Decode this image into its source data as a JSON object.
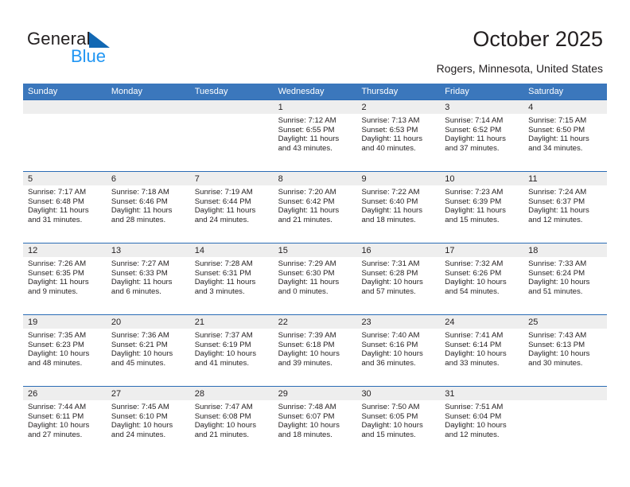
{
  "brand": {
    "name_part1": "General",
    "name_part2": "Blue",
    "accent_color": "#1268b3",
    "secondary_color": "#2196f3"
  },
  "header": {
    "title": "October 2025",
    "subtitle": "Rogers, Minnesota, United States"
  },
  "theme": {
    "header_band_color": "#3b77bc",
    "row_divider_color": "#2b6cb5",
    "daynum_strip_color": "#eeeeee",
    "text_color": "#231f20"
  },
  "weekdays": [
    "Sunday",
    "Monday",
    "Tuesday",
    "Wednesday",
    "Thursday",
    "Friday",
    "Saturday"
  ],
  "weeks": [
    [
      {
        "day": "",
        "sunrise": "",
        "sunset": "",
        "daylight": "",
        "empty": true
      },
      {
        "day": "",
        "sunrise": "",
        "sunset": "",
        "daylight": "",
        "empty": true
      },
      {
        "day": "",
        "sunrise": "",
        "sunset": "",
        "daylight": "",
        "empty": true
      },
      {
        "day": "1",
        "sunrise": "Sunrise: 7:12 AM",
        "sunset": "Sunset: 6:55 PM",
        "daylight": "Daylight: 11 hours and 43 minutes."
      },
      {
        "day": "2",
        "sunrise": "Sunrise: 7:13 AM",
        "sunset": "Sunset: 6:53 PM",
        "daylight": "Daylight: 11 hours and 40 minutes."
      },
      {
        "day": "3",
        "sunrise": "Sunrise: 7:14 AM",
        "sunset": "Sunset: 6:52 PM",
        "daylight": "Daylight: 11 hours and 37 minutes."
      },
      {
        "day": "4",
        "sunrise": "Sunrise: 7:15 AM",
        "sunset": "Sunset: 6:50 PM",
        "daylight": "Daylight: 11 hours and 34 minutes."
      }
    ],
    [
      {
        "day": "5",
        "sunrise": "Sunrise: 7:17 AM",
        "sunset": "Sunset: 6:48 PM",
        "daylight": "Daylight: 11 hours and 31 minutes."
      },
      {
        "day": "6",
        "sunrise": "Sunrise: 7:18 AM",
        "sunset": "Sunset: 6:46 PM",
        "daylight": "Daylight: 11 hours and 28 minutes."
      },
      {
        "day": "7",
        "sunrise": "Sunrise: 7:19 AM",
        "sunset": "Sunset: 6:44 PM",
        "daylight": "Daylight: 11 hours and 24 minutes."
      },
      {
        "day": "8",
        "sunrise": "Sunrise: 7:20 AM",
        "sunset": "Sunset: 6:42 PM",
        "daylight": "Daylight: 11 hours and 21 minutes."
      },
      {
        "day": "9",
        "sunrise": "Sunrise: 7:22 AM",
        "sunset": "Sunset: 6:40 PM",
        "daylight": "Daylight: 11 hours and 18 minutes."
      },
      {
        "day": "10",
        "sunrise": "Sunrise: 7:23 AM",
        "sunset": "Sunset: 6:39 PM",
        "daylight": "Daylight: 11 hours and 15 minutes."
      },
      {
        "day": "11",
        "sunrise": "Sunrise: 7:24 AM",
        "sunset": "Sunset: 6:37 PM",
        "daylight": "Daylight: 11 hours and 12 minutes."
      }
    ],
    [
      {
        "day": "12",
        "sunrise": "Sunrise: 7:26 AM",
        "sunset": "Sunset: 6:35 PM",
        "daylight": "Daylight: 11 hours and 9 minutes."
      },
      {
        "day": "13",
        "sunrise": "Sunrise: 7:27 AM",
        "sunset": "Sunset: 6:33 PM",
        "daylight": "Daylight: 11 hours and 6 minutes."
      },
      {
        "day": "14",
        "sunrise": "Sunrise: 7:28 AM",
        "sunset": "Sunset: 6:31 PM",
        "daylight": "Daylight: 11 hours and 3 minutes."
      },
      {
        "day": "15",
        "sunrise": "Sunrise: 7:29 AM",
        "sunset": "Sunset: 6:30 PM",
        "daylight": "Daylight: 11 hours and 0 minutes."
      },
      {
        "day": "16",
        "sunrise": "Sunrise: 7:31 AM",
        "sunset": "Sunset: 6:28 PM",
        "daylight": "Daylight: 10 hours and 57 minutes."
      },
      {
        "day": "17",
        "sunrise": "Sunrise: 7:32 AM",
        "sunset": "Sunset: 6:26 PM",
        "daylight": "Daylight: 10 hours and 54 minutes."
      },
      {
        "day": "18",
        "sunrise": "Sunrise: 7:33 AM",
        "sunset": "Sunset: 6:24 PM",
        "daylight": "Daylight: 10 hours and 51 minutes."
      }
    ],
    [
      {
        "day": "19",
        "sunrise": "Sunrise: 7:35 AM",
        "sunset": "Sunset: 6:23 PM",
        "daylight": "Daylight: 10 hours and 48 minutes."
      },
      {
        "day": "20",
        "sunrise": "Sunrise: 7:36 AM",
        "sunset": "Sunset: 6:21 PM",
        "daylight": "Daylight: 10 hours and 45 minutes."
      },
      {
        "day": "21",
        "sunrise": "Sunrise: 7:37 AM",
        "sunset": "Sunset: 6:19 PM",
        "daylight": "Daylight: 10 hours and 41 minutes."
      },
      {
        "day": "22",
        "sunrise": "Sunrise: 7:39 AM",
        "sunset": "Sunset: 6:18 PM",
        "daylight": "Daylight: 10 hours and 39 minutes."
      },
      {
        "day": "23",
        "sunrise": "Sunrise: 7:40 AM",
        "sunset": "Sunset: 6:16 PM",
        "daylight": "Daylight: 10 hours and 36 minutes."
      },
      {
        "day": "24",
        "sunrise": "Sunrise: 7:41 AM",
        "sunset": "Sunset: 6:14 PM",
        "daylight": "Daylight: 10 hours and 33 minutes."
      },
      {
        "day": "25",
        "sunrise": "Sunrise: 7:43 AM",
        "sunset": "Sunset: 6:13 PM",
        "daylight": "Daylight: 10 hours and 30 minutes."
      }
    ],
    [
      {
        "day": "26",
        "sunrise": "Sunrise: 7:44 AM",
        "sunset": "Sunset: 6:11 PM",
        "daylight": "Daylight: 10 hours and 27 minutes."
      },
      {
        "day": "27",
        "sunrise": "Sunrise: 7:45 AM",
        "sunset": "Sunset: 6:10 PM",
        "daylight": "Daylight: 10 hours and 24 minutes."
      },
      {
        "day": "28",
        "sunrise": "Sunrise: 7:47 AM",
        "sunset": "Sunset: 6:08 PM",
        "daylight": "Daylight: 10 hours and 21 minutes."
      },
      {
        "day": "29",
        "sunrise": "Sunrise: 7:48 AM",
        "sunset": "Sunset: 6:07 PM",
        "daylight": "Daylight: 10 hours and 18 minutes."
      },
      {
        "day": "30",
        "sunrise": "Sunrise: 7:50 AM",
        "sunset": "Sunset: 6:05 PM",
        "daylight": "Daylight: 10 hours and 15 minutes."
      },
      {
        "day": "31",
        "sunrise": "Sunrise: 7:51 AM",
        "sunset": "Sunset: 6:04 PM",
        "daylight": "Daylight: 10 hours and 12 minutes."
      },
      {
        "day": "",
        "sunrise": "",
        "sunset": "",
        "daylight": "",
        "empty": true
      }
    ]
  ]
}
